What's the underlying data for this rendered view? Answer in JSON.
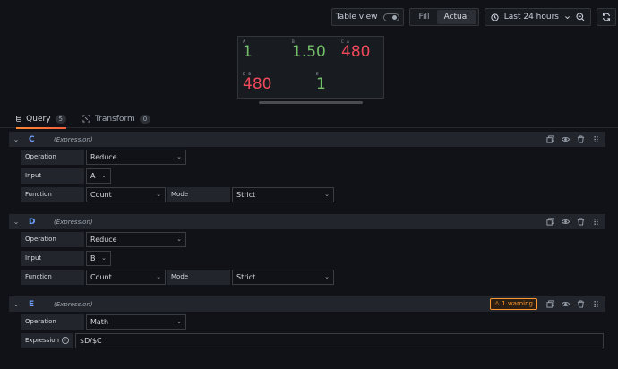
{
  "toolbar": {
    "table_view_label": "Table view",
    "fill_label": "Fill",
    "actual_label": "Actual",
    "time_range_label": "Last 24 hours"
  },
  "preview": {
    "stats": [
      {
        "label": "A",
        "value": "1",
        "color": "#73bf69"
      },
      {
        "label": "B",
        "value": "1.50",
        "color": "#73bf69"
      },
      {
        "label": "C A",
        "value": "480",
        "color": "#f2495c"
      },
      {
        "label": "D B",
        "value": "480",
        "color": "#f2495c"
      },
      {
        "label": "E",
        "value": "1",
        "color": "#73bf69"
      }
    ]
  },
  "tabs": [
    {
      "label": "Query",
      "count": "5"
    },
    {
      "label": "Transform",
      "count": "0"
    }
  ],
  "queries": [
    {
      "ref": "C",
      "type": "(Expression)",
      "operation_label": "Operation",
      "operation": "Reduce",
      "input_label": "Input",
      "input": "A",
      "function_label": "Function",
      "function": "Count",
      "mode_label": "Mode",
      "mode": "Strict"
    },
    {
      "ref": "D",
      "type": "(Expression)",
      "operation_label": "Operation",
      "operation": "Reduce",
      "input_label": "Input",
      "input": "B",
      "function_label": "Function",
      "function": "Count",
      "mode_label": "Mode",
      "mode": "Strict"
    },
    {
      "ref": "E",
      "type": "(Expression)",
      "warning": "1 warning",
      "operation_label": "Operation",
      "operation": "Math",
      "expression_label": "Expression",
      "expression": "$D/$C"
    }
  ]
}
